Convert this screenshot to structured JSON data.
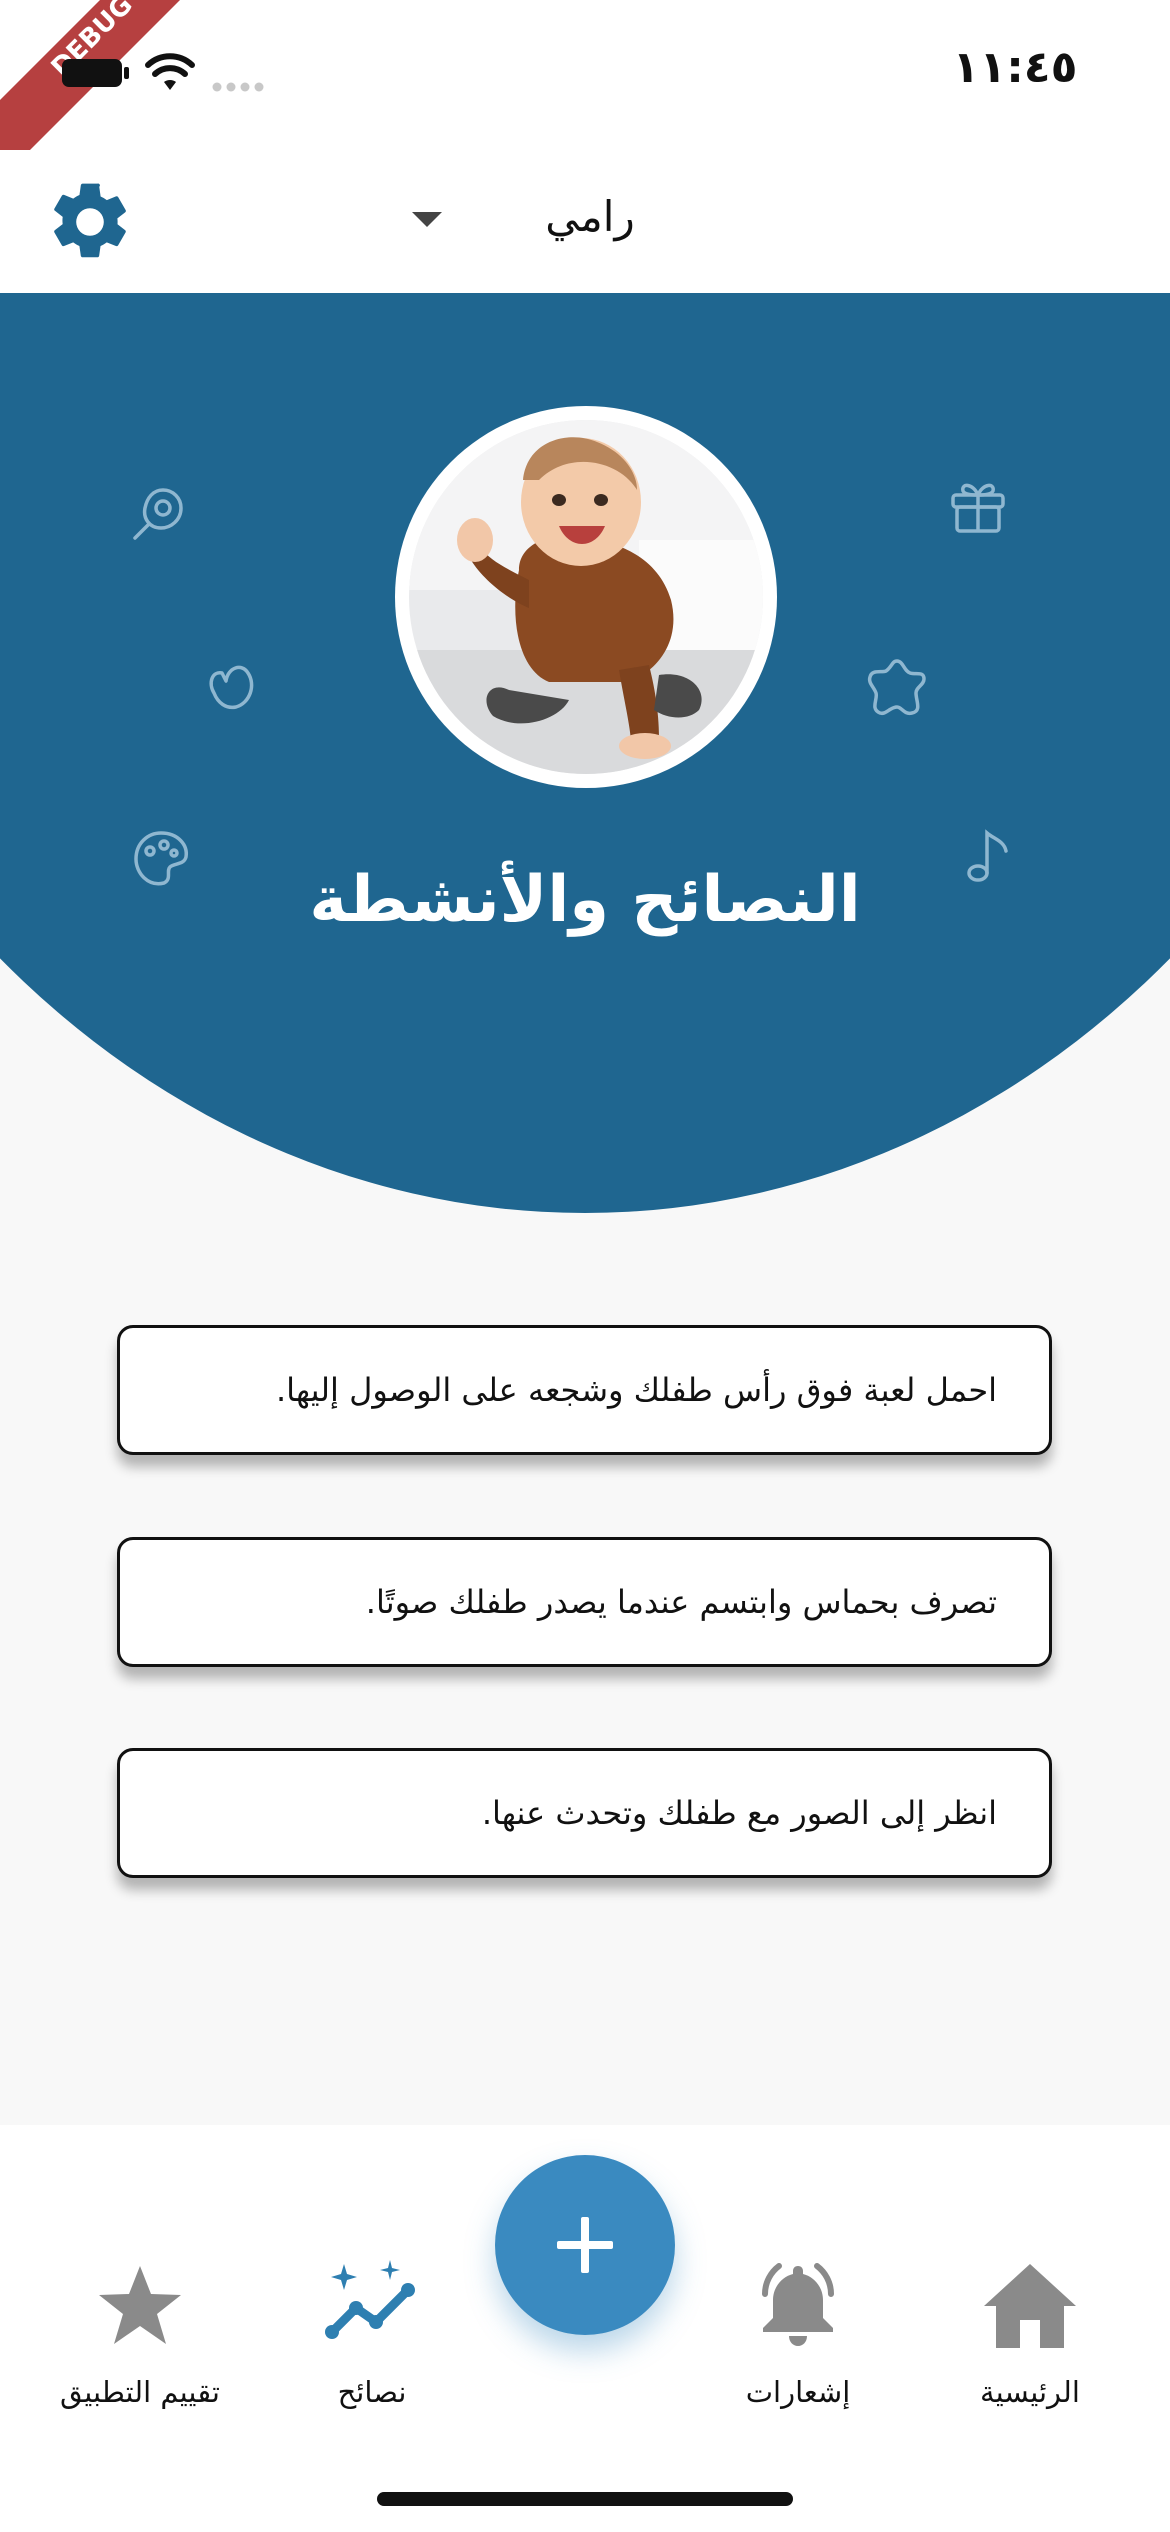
{
  "status_bar": {
    "time": "١١:٤٥",
    "debug_banner": "DEBUG"
  },
  "app_bar": {
    "child_name": "رامي",
    "settings_icon": "gear-icon",
    "dropdown_icon": "chevron-down-icon"
  },
  "hero": {
    "title": "النصائح والأنشطة",
    "background_color": "#1f6690"
  },
  "tips": [
    {
      "text": "احمل لعبة فوق رأس طفلك وشجعه على الوصول إليها."
    },
    {
      "text": "تصرف بحماس وابتسم عندما يصدر طفلك صوتًا."
    },
    {
      "text": "انظر إلى الصور مع طفلك وتحدث عنها."
    }
  ],
  "bottom_nav": {
    "items": [
      {
        "label": "الرئيسية",
        "icon": "home-icon"
      },
      {
        "label": "إشعارات",
        "icon": "bell-icon"
      },
      {
        "label": "نصائح",
        "icon": "sparkle-chart-icon"
      },
      {
        "label": "تقييم التطبيق",
        "icon": "star-icon"
      }
    ],
    "fab_icon": "plus-icon",
    "active_color": "#2e7fb1",
    "inactive_color": "#8a8a8a"
  }
}
